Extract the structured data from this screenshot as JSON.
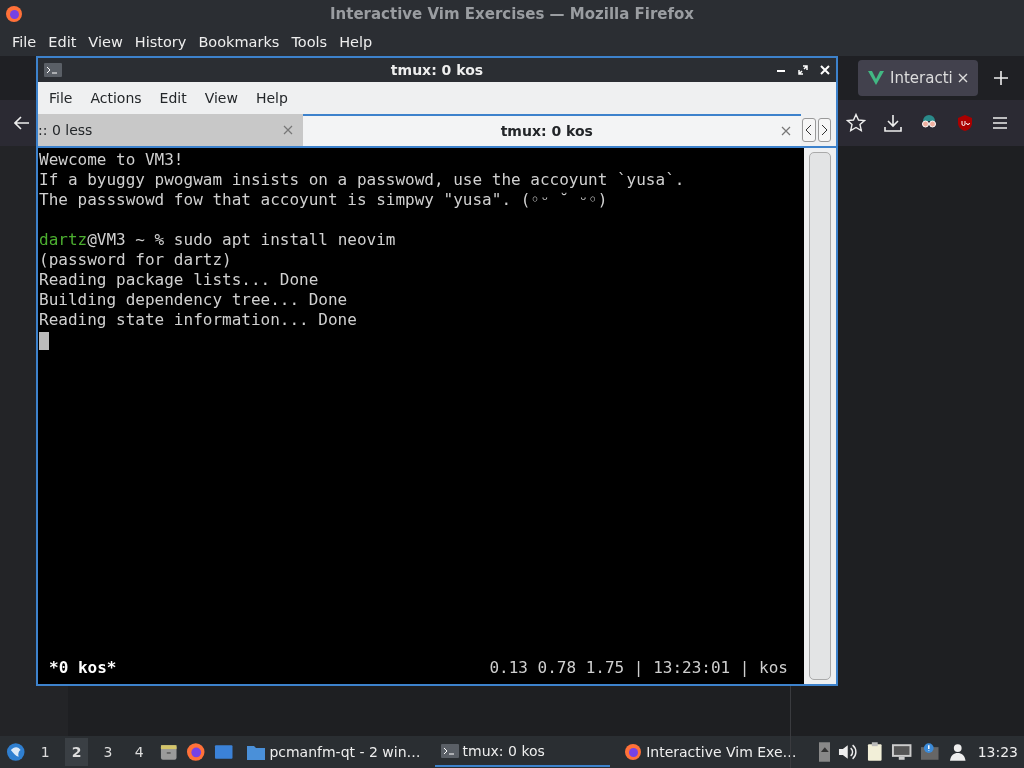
{
  "firefox": {
    "title": "Interactive Vim Exercises — Mozilla Firefox",
    "menu": [
      "File",
      "Edit",
      "View",
      "History",
      "Bookmarks",
      "Tools",
      "Help"
    ],
    "tabs": [
      {
        "label": "Interacti",
        "selected": true
      }
    ]
  },
  "terminal": {
    "title": "tmux: 0 kos",
    "menu": [
      "File",
      "Actions",
      "Edit",
      "View",
      "Help"
    ],
    "tabs": [
      {
        "label": ":: 0 less",
        "selected": false
      },
      {
        "label": "tmux: 0 kos",
        "selected": true
      }
    ],
    "lines": [
      {
        "kind": "text",
        "text": "Wewcome to VM3!"
      },
      {
        "kind": "text",
        "text": "If a byuggy pwogwam insists on a passwowd, use the accoyunt `yusa`."
      },
      {
        "kind": "text",
        "text": "The passswowd fow that accoyunt is simpwy \"yusa\". (◦ᵕ ˘ ᵕ◦)"
      },
      {
        "kind": "blank"
      },
      {
        "kind": "prompt",
        "user": "dartz",
        "rest": "@VM3 ~ % sudo apt install neovim"
      },
      {
        "kind": "text",
        "text": "(password for dartz)"
      },
      {
        "kind": "text",
        "text": "Reading package lists... Done"
      },
      {
        "kind": "text",
        "text": "Building dependency tree... Done"
      },
      {
        "kind": "text",
        "text": "Reading state information... Done"
      },
      {
        "kind": "cursor"
      }
    ],
    "status_left": "*0 kos*",
    "status_right": "0.13 0.78 1.75 | 13:23:01 | kos"
  },
  "taskbar": {
    "workspaces": [
      {
        "label": "1",
        "selected": false
      },
      {
        "label": "2",
        "selected": true
      },
      {
        "label": "3",
        "selected": false
      },
      {
        "label": "4",
        "selected": false
      }
    ],
    "tasks": [
      {
        "label": "pcmanfm-qt - 2 win…",
        "kind": "folder",
        "selected": false
      },
      {
        "label": "tmux: 0 kos",
        "kind": "terminal",
        "selected": true
      },
      {
        "label": "Interactive Vim Exe…",
        "kind": "firefox",
        "selected": false
      }
    ],
    "clock": "13:23"
  }
}
